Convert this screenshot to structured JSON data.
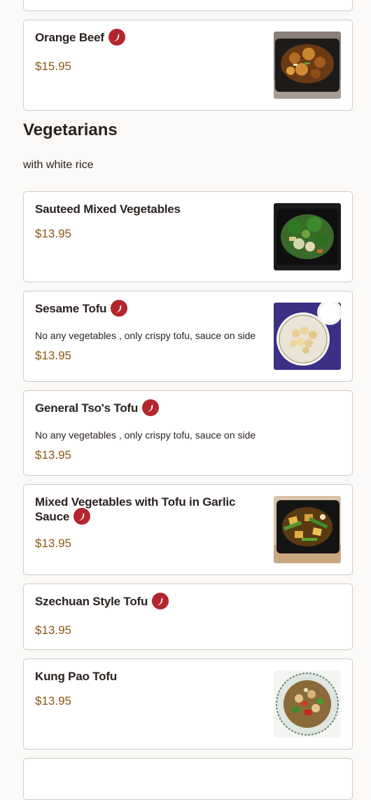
{
  "section": {
    "title": "Vegetarians",
    "subtitle": "with white rice"
  },
  "icons": {
    "spicy": "chili-pepper-icon",
    "spicy_color": "#b3262e"
  },
  "colors": {
    "price": "#8a5a14",
    "border": "#cfc9c4",
    "background": "#faf9f7"
  },
  "items": [
    {
      "name": "Orange Beef",
      "price": "$15.95",
      "spicy": true,
      "has_photo": true
    },
    {
      "name": "Sauteed Mixed Vegetables",
      "price": "$13.95",
      "spicy": false,
      "has_photo": true
    },
    {
      "name": "Sesame Tofu",
      "description": "No any vegetables , only crispy tofu, sauce on side",
      "price": "$13.95",
      "spicy": true,
      "has_photo": true
    },
    {
      "name": "General Tso's Tofu",
      "description": "No any vegetables , only crispy tofu, sauce on side",
      "price": "$13.95",
      "spicy": true,
      "has_photo": false
    },
    {
      "name": "Mixed Vegetables with Tofu in Garlic Sauce",
      "price": "$13.95",
      "spicy": true,
      "has_photo": true
    },
    {
      "name": "Szechuan Style Tofu",
      "price": "$13.95",
      "spicy": true,
      "has_photo": false
    },
    {
      "name": "Kung Pao Tofu",
      "price": "$13.95",
      "spicy": false,
      "has_photo": true
    }
  ]
}
